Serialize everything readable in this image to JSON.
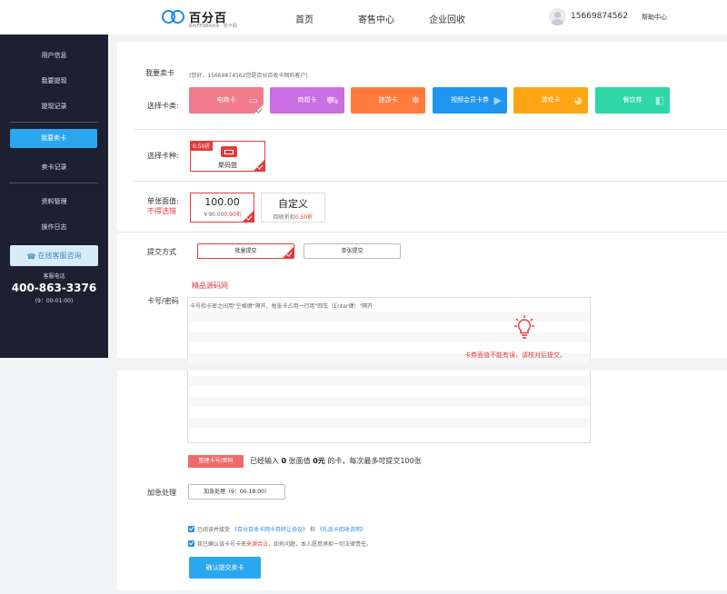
{
  "header": {
    "logo_text": "百分百",
    "logo_sub": "BAIFENBAIKA · 收卡网",
    "nav": [
      "首页",
      "寄售中心",
      "企业回收"
    ],
    "user_phone": "15669874562",
    "help": "帮助中心"
  },
  "sidebar": {
    "items": [
      "用户信息",
      "我要提现",
      "提现记录",
      "我要卖卡",
      "卖卡记录",
      "资料管理",
      "操作日志"
    ],
    "consult": "在线客服咨询",
    "tel_label": "客服电话",
    "tel": "400-863-3376",
    "hours": "(9：00-01:00)"
  },
  "main": {
    "title": "我要卖卡",
    "greeting": "(您好，15669874562您是百分百收卡网的客户)",
    "choose_type_label": "选择卡类:",
    "card_types": [
      {
        "label": "电商卡",
        "color": "#f07b8c",
        "icon": "shopping-icon"
      },
      {
        "label": "商超卡",
        "color": "#c96ee3",
        "icon": "shopping-cart-icon"
      },
      {
        "label": "旅游卡",
        "color": "#ff7b3c",
        "icon": "palm-tree-icon"
      },
      {
        "label": "视频会员卡券",
        "color": "#1f95ef",
        "icon": "video-icon"
      },
      {
        "label": "游戏卡",
        "color": "#ffa414",
        "icon": "gamepad-icon"
      },
      {
        "label": "餐饮券",
        "color": "#2fd6a6",
        "icon": "food-icon"
      }
    ],
    "choose_kind_label": "选择卡种:",
    "kind": {
      "tag": "0.50折",
      "name": "聚码盟"
    },
    "face_label": "单张面值:",
    "face_warn": "不得选错",
    "face_options": [
      {
        "value": "100.00",
        "sub_prefix": "￥90.00",
        "sub_rate": "0.90折"
      },
      {
        "value": "自定义",
        "sub_prefix": "回收折扣",
        "sub_rate": "0.50折"
      }
    ],
    "submit_mode_label": "提交方式",
    "submit_modes": [
      "批量提交",
      "单张提交"
    ],
    "watermark_text": "精品源码网",
    "card_pwd_label": "卡号/密码",
    "textarea_placeholder": "卡号和卡密之间用\"空格键\"隔开，每张卡占用一行用\"回车（Enter键）\"隔开",
    "warning": "卡券面值不能有误，请核对后提交。",
    "arrange_button": "整理卡号/密码",
    "count_prefix": "已经输入",
    "count_cards": "0",
    "count_mid1": "张面值",
    "count_value": "0元",
    "count_suffix": "的卡，每次最多可提交100张",
    "urgent_label": "加急处理",
    "urgent_button": "加急处理（9：00-18:00）",
    "agree1_prefix": "已阅读并接受",
    "agree1_link1": "《百分百收卡网卡券转让协议》",
    "agree1_and": "和",
    "agree1_link2": "《礼品卡回收说明》",
    "agree2_prefix": "我已确认该卡号卡密",
    "agree2_red": "来源合法",
    "agree2_suffix": "，如有问题，本人愿意承担一切法律责任。",
    "submit_button": "确认提交卖卡"
  }
}
